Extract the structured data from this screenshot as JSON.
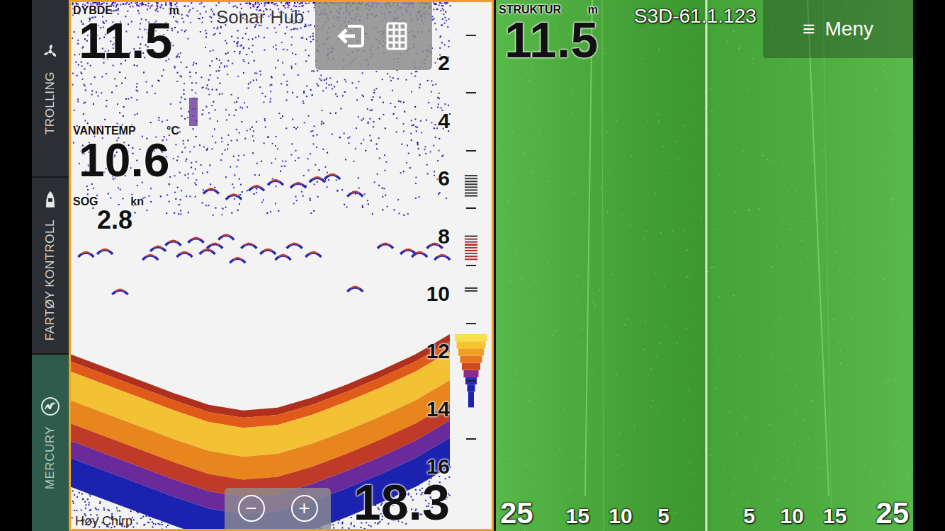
{
  "sidebar": {
    "items": [
      {
        "label": "TROLLING",
        "selected": false
      },
      {
        "label": "FARTØY KONTROLL",
        "selected": false
      },
      {
        "label": "MERCURY",
        "selected": true
      }
    ]
  },
  "toolbar": {
    "title": "Sonar Hub"
  },
  "sonar": {
    "selected": true,
    "readouts": [
      {
        "label": "DYBDE",
        "unit": "m",
        "value": "11.5"
      },
      {
        "label": "VANNTEMP",
        "unit": "°C",
        "value": "10.6"
      },
      {
        "label": "SOG",
        "unit": "kn",
        "value": "2.8"
      }
    ],
    "depth_scale": [
      "2",
      "4",
      "6",
      "8",
      "10",
      "12",
      "14",
      "16"
    ],
    "range": "18.3",
    "mode": "Høy Chirp",
    "zoom": {
      "out": "−",
      "in": "+"
    },
    "bottom_depths": [
      12.1,
      12.55,
      13.0,
      13.45,
      13.85,
      14.05,
      13.95,
      13.6,
      13.15,
      12.65,
      12.1,
      11.4
    ],
    "fish": [
      {
        "x": 0.04,
        "depth": 8.6
      },
      {
        "x": 0.09,
        "depth": 8.5
      },
      {
        "x": 0.13,
        "depth": 9.9
      },
      {
        "x": 0.21,
        "depth": 8.7
      },
      {
        "x": 0.23,
        "depth": 8.4
      },
      {
        "x": 0.27,
        "depth": 8.2
      },
      {
        "x": 0.3,
        "depth": 8.6
      },
      {
        "x": 0.33,
        "depth": 8.1
      },
      {
        "x": 0.36,
        "depth": 8.5
      },
      {
        "x": 0.38,
        "depth": 8.3
      },
      {
        "x": 0.37,
        "depth": 6.4
      },
      {
        "x": 0.41,
        "depth": 8.0
      },
      {
        "x": 0.43,
        "depth": 6.6
      },
      {
        "x": 0.44,
        "depth": 8.8
      },
      {
        "x": 0.47,
        "depth": 8.3
      },
      {
        "x": 0.49,
        "depth": 6.3
      },
      {
        "x": 0.52,
        "depth": 8.5
      },
      {
        "x": 0.54,
        "depth": 6.1
      },
      {
        "x": 0.56,
        "depth": 8.7
      },
      {
        "x": 0.59,
        "depth": 8.3
      },
      {
        "x": 0.6,
        "depth": 6.2
      },
      {
        "x": 0.64,
        "depth": 8.6
      },
      {
        "x": 0.65,
        "depth": 6.0
      },
      {
        "x": 0.69,
        "depth": 5.9
      },
      {
        "x": 0.75,
        "depth": 6.5
      },
      {
        "x": 0.75,
        "depth": 9.8
      },
      {
        "x": 0.83,
        "depth": 8.3
      },
      {
        "x": 0.89,
        "depth": 8.5
      },
      {
        "x": 0.92,
        "depth": 8.6
      },
      {
        "x": 0.96,
        "depth": 8.3
      },
      {
        "x": 0.98,
        "depth": 8.7
      }
    ]
  },
  "structure": {
    "selected": false,
    "readout": {
      "label": "STRUKTUR",
      "unit": "m",
      "value": "11.5"
    },
    "source": "S3D-61.1.123",
    "range_labels": [
      "25",
      "15",
      "10",
      "5",
      "5",
      "10",
      "15",
      "25"
    ]
  },
  "menu": {
    "icon": "≡",
    "label": "Meny"
  }
}
